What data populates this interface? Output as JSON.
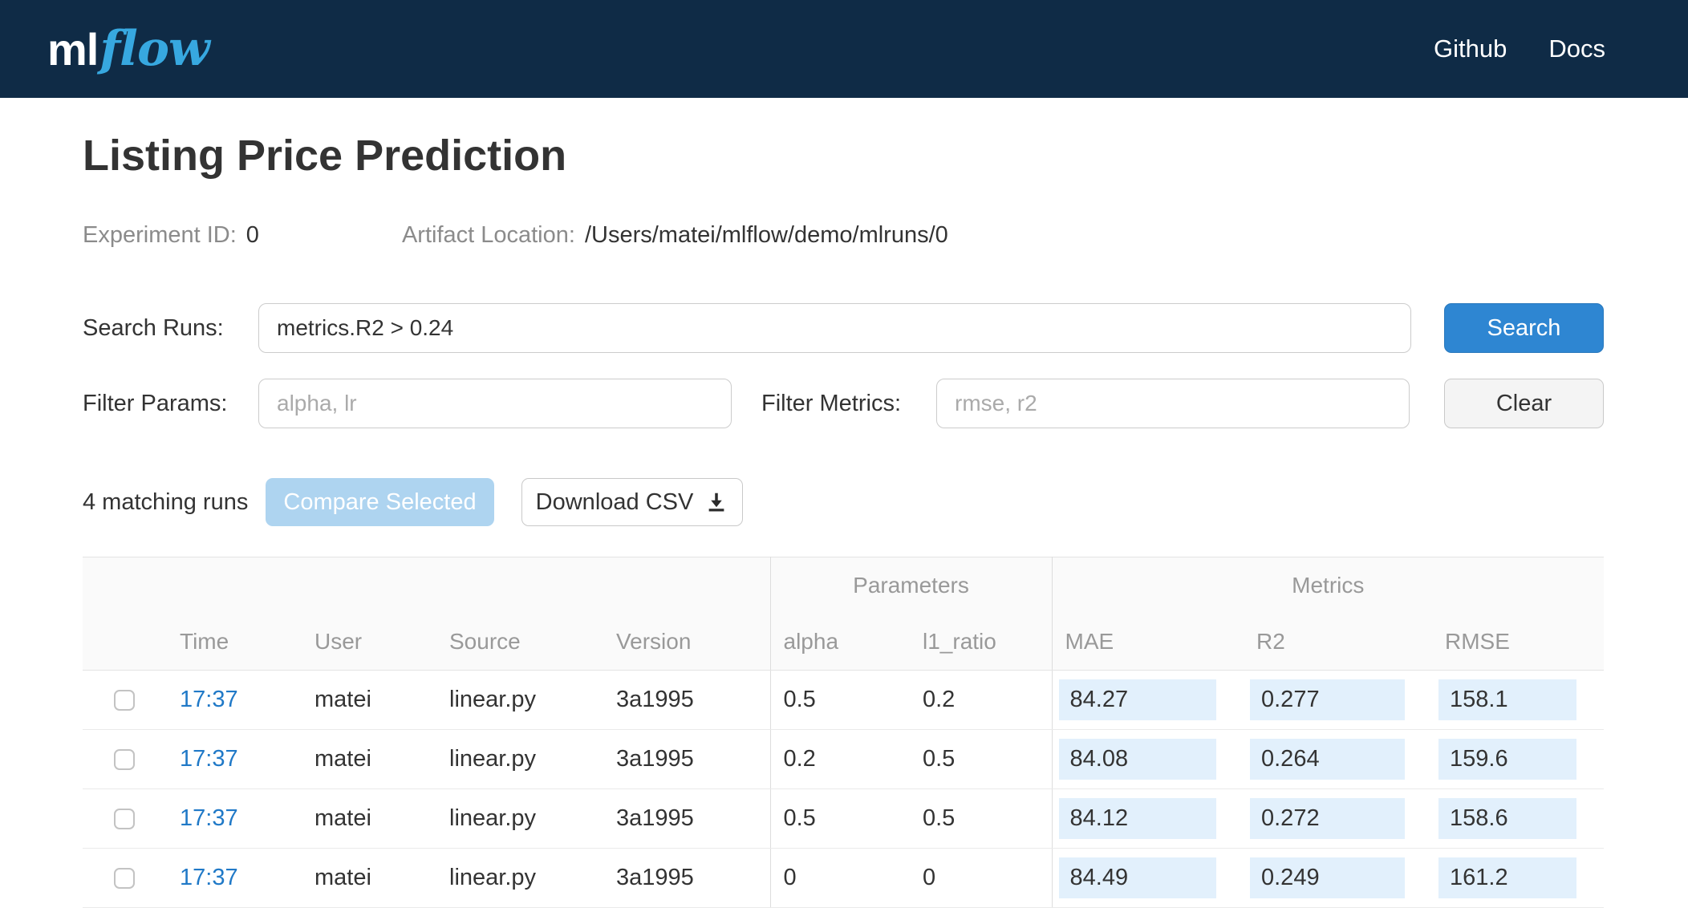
{
  "header": {
    "logo_ml": "ml",
    "logo_flow": "flow",
    "nav": [
      {
        "label": "Github"
      },
      {
        "label": "Docs"
      }
    ]
  },
  "page": {
    "title": "Listing Price Prediction",
    "experiment_id_label": "Experiment ID:",
    "experiment_id": "0",
    "artifact_location_label": "Artifact Location:",
    "artifact_location": "/Users/matei/mlflow/demo/mlruns/0"
  },
  "search": {
    "search_runs_label": "Search Runs:",
    "search_value": "metrics.R2 > 0.24",
    "search_button": "Search",
    "filter_params_label": "Filter Params:",
    "filter_params_placeholder": "alpha, lr",
    "filter_metrics_label": "Filter Metrics:",
    "filter_metrics_placeholder": "rmse, r2",
    "clear_button": "Clear"
  },
  "results": {
    "matching_runs": "4 matching runs",
    "compare_button": "Compare Selected",
    "download_button": "Download CSV",
    "download_icon": "download-icon"
  },
  "table": {
    "groups": {
      "parameters": "Parameters",
      "metrics": "Metrics"
    },
    "columns": [
      "Time",
      "User",
      "Source",
      "Version",
      "alpha",
      "l1_ratio",
      "MAE",
      "R2",
      "RMSE"
    ],
    "rows": [
      {
        "time": "17:37",
        "user": "matei",
        "source": "linear.py",
        "version": "3a1995",
        "alpha": "0.5",
        "l1_ratio": "0.2",
        "mae": "84.27",
        "r2": "0.277",
        "rmse": "158.1"
      },
      {
        "time": "17:37",
        "user": "matei",
        "source": "linear.py",
        "version": "3a1995",
        "alpha": "0.2",
        "l1_ratio": "0.5",
        "mae": "84.08",
        "r2": "0.264",
        "rmse": "159.6"
      },
      {
        "time": "17:37",
        "user": "matei",
        "source": "linear.py",
        "version": "3a1995",
        "alpha": "0.5",
        "l1_ratio": "0.5",
        "mae": "84.12",
        "r2": "0.272",
        "rmse": "158.6"
      },
      {
        "time": "17:37",
        "user": "matei",
        "source": "linear.py",
        "version": "3a1995",
        "alpha": "0",
        "l1_ratio": "0",
        "mae": "84.49",
        "r2": "0.249",
        "rmse": "161.2"
      }
    ]
  },
  "colors": {
    "header_bg": "#0f2b46",
    "logo_blue": "#37a8e0",
    "link_blue": "#2079c7",
    "primary_blue": "#2e86d2",
    "compare_disabled_blue": "#aed4f0",
    "metric_highlight": "#e2f0fc"
  }
}
